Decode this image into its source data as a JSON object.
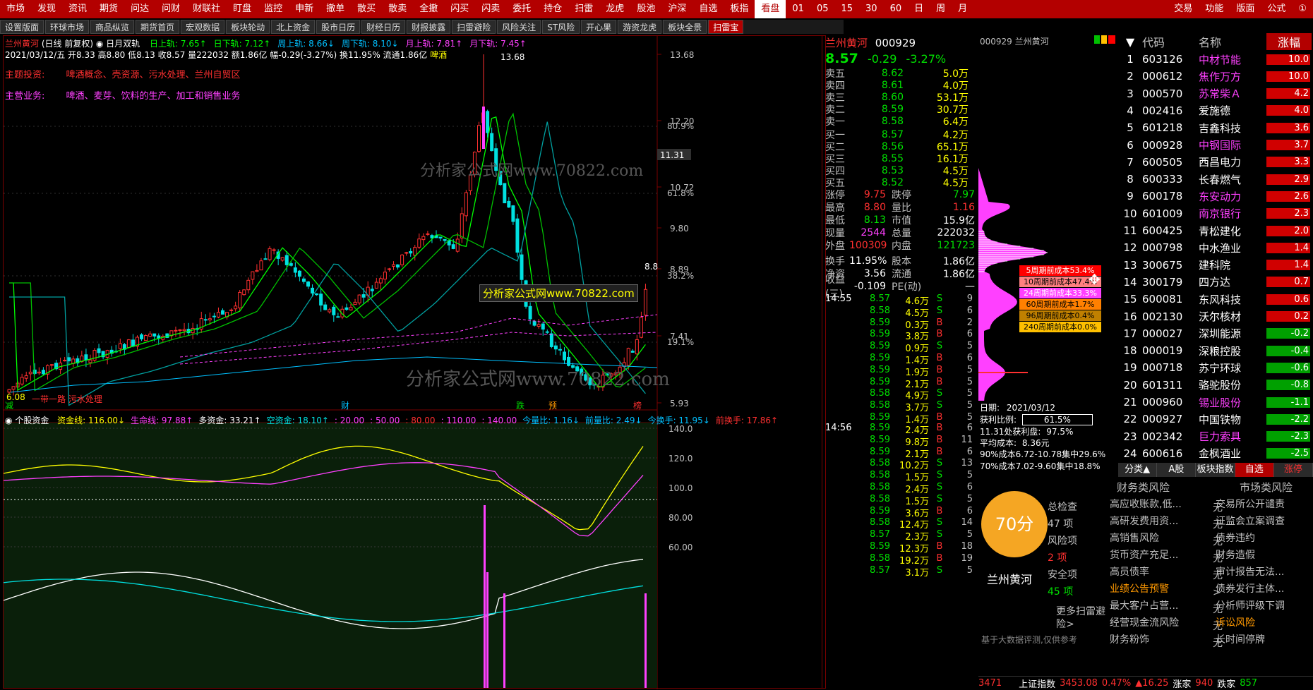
{
  "topbar": {
    "items": [
      "市场",
      "发现",
      "资讯",
      "期货",
      "问达",
      "问财",
      "财联社",
      "盯盘",
      "监控",
      "申新",
      "撤单",
      "散买",
      "散卖",
      "全撤",
      "闪买",
      "闪卖",
      "委托",
      "持仓",
      "扫雷",
      "龙虎",
      "股池",
      "沪深",
      "自选",
      "板指",
      "看盘",
      "01",
      "05",
      "15",
      "30",
      "60",
      "日",
      "周",
      "月"
    ],
    "right": [
      "交易",
      "功能",
      "版面",
      "公式",
      "①"
    ]
  },
  "tabs": [
    "设置版面",
    "环球市场",
    "商品纵览",
    "期货首页",
    "宏观数据",
    "板块轮动",
    "北上资金",
    "股市日历",
    "财经日历",
    "财报披露",
    "扫雷避险",
    "风险关注",
    "ST风险",
    "开心果",
    "游资龙虎",
    "板块全景",
    "扫雷宝"
  ],
  "chart": {
    "title_stock": "兰州黄河",
    "title_mode": "(日线 前复权)",
    "title_ind": "日月双轨",
    "ind_items": [
      {
        "t": "日上轨: 7.65↑",
        "c": "#00ff00"
      },
      {
        "t": "日下轨: 7.12↑",
        "c": "#00ff00"
      },
      {
        "t": "周上轨: 8.66↓",
        "c": "#00c0ff"
      },
      {
        "t": "周下轨: 8.10↓",
        "c": "#00c0ff"
      },
      {
        "t": "月上轨: 7.81↑",
        "c": "#ff40ff"
      },
      {
        "t": "月下轨: 7.45↑",
        "c": "#ff40ff"
      }
    ],
    "line2": "2021/03/12/五 开8.33 高8.80 低8.13 收8.57 量222032 额1.86亿 幅-0.29(-3.27%) 换11.95% 流通1.86亿",
    "line2_tag": "啤酒",
    "theme_label": "主题投资:",
    "theme_value": "啤酒概念、壳资源、污水处理、兰州自贸区",
    "biz_label": "主营业务:",
    "biz_value": "啤酒、麦芽、饮料的生产、加工和销售业务",
    "price_labels": [
      "13.68",
      "12.20",
      "10.72",
      "9.80",
      "8.89",
      "7.41",
      "5.93"
    ],
    "pct_labels": [
      "80.9%",
      "61.8%",
      "38.2%",
      "19.1%"
    ],
    "cur_price": "11.31",
    "high_mark": "13.68",
    "low_mark": "6.08",
    "right_mark": "8.8",
    "bottom_note": "一带一路 污水处理",
    "markers": [
      "减",
      "财",
      "跌",
      "预",
      "榜"
    ],
    "watermark1": "分析家公式网www.70822.com",
    "watermark2": "分析家公式网www.70822.com",
    "watermark3": "分析家公式网www.70822.com",
    "sub_title": "个股资金",
    "sub_items": [
      {
        "t": "资金线: 116.00↓",
        "c": "#ffff00"
      },
      {
        "t": "生命线: 97.88↑",
        "c": "#ff40ff"
      },
      {
        "t": "多资金: 33.21↑",
        "c": "#ffffff"
      },
      {
        "t": "空资金: 18.10↑",
        "c": "#00e0e0"
      },
      {
        "t": ": 20.00",
        "c": "#ff40ff"
      },
      {
        "t": ": 50.00",
        "c": "#ff40ff"
      },
      {
        "t": ": 80.00",
        "c": "#ff3030"
      },
      {
        "t": ": 110.00",
        "c": "#ff40ff"
      },
      {
        "t": ": 140.00",
        "c": "#ff40ff"
      },
      {
        "t": "今量比: 1.16↓",
        "c": "#00c0ff"
      },
      {
        "t": "前量比: 2.49↓",
        "c": "#00c0ff"
      },
      {
        "t": "今换手: 11.95↓",
        "c": "#00c0ff"
      },
      {
        "t": "前换手: 17.86↑",
        "c": "#ff3030"
      }
    ],
    "sub_labels": [
      "140.0",
      "120.0",
      "100.0",
      "80.00",
      "60.00"
    ]
  },
  "book": {
    "name": "兰州黄河",
    "code": "000929",
    "price": "8.57",
    "chg": "-0.29",
    "pct": "-3.27%",
    "asks": [
      {
        "l": "卖五",
        "p": "8.62",
        "v": "5.0万"
      },
      {
        "l": "卖四",
        "p": "8.61",
        "v": "4.0万"
      },
      {
        "l": "卖三",
        "p": "8.60",
        "v": "53.1万"
      },
      {
        "l": "卖二",
        "p": "8.59",
        "v": "30.7万"
      },
      {
        "l": "卖一",
        "p": "8.58",
        "v": "6.4万"
      }
    ],
    "bids": [
      {
        "l": "买一",
        "p": "8.57",
        "v": "4.2万"
      },
      {
        "l": "买二",
        "p": "8.56",
        "v": "65.1万"
      },
      {
        "l": "买三",
        "p": "8.55",
        "v": "16.1万"
      },
      {
        "l": "买四",
        "p": "8.53",
        "v": "4.5万"
      },
      {
        "l": "买五",
        "p": "8.52",
        "v": "4.5万"
      }
    ],
    "stats": [
      {
        "a": "涨停",
        "av": "9.75",
        "ac": "#ff3030",
        "b": "跌停",
        "bv": "7.97",
        "bc": "#00e000"
      },
      {
        "a": "最高",
        "av": "8.80",
        "ac": "#ff3030",
        "b": "量比",
        "bv": "1.16",
        "bc": "#ff3030"
      },
      {
        "a": "最低",
        "av": "8.13",
        "ac": "#00e000",
        "b": "市值",
        "bv": "15.9亿",
        "bc": "#ffffff"
      },
      {
        "a": "现量",
        "av": "2544",
        "ac": "#ff40ff",
        "b": "总量",
        "bv": "222032",
        "bc": "#ffffff"
      },
      {
        "a": "外盘",
        "av": "100309",
        "ac": "#ff3030",
        "b": "内盘",
        "bv": "121723",
        "bc": "#00e000"
      },
      {
        "a": "换手",
        "av": "11.95%",
        "ac": "#ffffff",
        "b": "股本",
        "bv": "1.86亿",
        "bc": "#ffffff"
      },
      {
        "a": "净资",
        "av": "3.56",
        "ac": "#ffffff",
        "b": "流通",
        "bv": "1.86亿",
        "bc": "#ffffff"
      },
      {
        "a": "收益(三)",
        "av": "-0.109",
        "ac": "#ffffff",
        "b": "PE(动)",
        "bv": "—",
        "bc": "#ffffff"
      }
    ],
    "ticks1_time": "14:55",
    "ticks1": [
      {
        "p": "8.57",
        "v": "4.6万",
        "s": "S",
        "n": "9"
      },
      {
        "p": "8.58",
        "v": "4.5万",
        "s": "S",
        "n": "6"
      },
      {
        "p": "8.59",
        "v": "0.3万",
        "s": "B",
        "n": "2"
      },
      {
        "p": "8.59",
        "v": "3.8万",
        "s": "B",
        "n": "6"
      },
      {
        "p": "8.59",
        "v": "0.9万",
        "s": "S",
        "n": "5"
      },
      {
        "p": "8.59",
        "v": "1.4万",
        "s": "B",
        "n": "6"
      },
      {
        "p": "8.59",
        "v": "1.9万",
        "s": "B",
        "n": "5"
      },
      {
        "p": "8.59",
        "v": "2.1万",
        "s": "B",
        "n": "5"
      },
      {
        "p": "8.58",
        "v": "4.9万",
        "s": "S",
        "n": "5"
      },
      {
        "p": "8.58",
        "v": "3.7万",
        "s": "S",
        "n": "5"
      },
      {
        "p": "8.59",
        "v": "1.4万",
        "s": "B",
        "n": "5"
      }
    ],
    "ticks2_time": "14:56",
    "ticks2": [
      {
        "p": "8.59",
        "v": "2.4万",
        "s": "B",
        "n": "6"
      },
      {
        "p": "8.59",
        "v": "9.8万",
        "s": "B",
        "n": "11"
      },
      {
        "p": "8.59",
        "v": "2.1万",
        "s": "B",
        "n": "6"
      },
      {
        "p": "8.58",
        "v": "10.2万",
        "s": "S",
        "n": "13"
      },
      {
        "p": "8.58",
        "v": "1.5万",
        "s": "S",
        "n": "5"
      },
      {
        "p": "8.58",
        "v": "2.4万",
        "s": "S",
        "n": "6"
      },
      {
        "p": "8.58",
        "v": "1.5万",
        "s": "S",
        "n": "5"
      },
      {
        "p": "8.59",
        "v": "3.6万",
        "s": "B",
        "n": "6"
      },
      {
        "p": "8.58",
        "v": "12.4万",
        "s": "S",
        "n": "14"
      },
      {
        "p": "8.57",
        "v": "2.3万",
        "s": "S",
        "n": "5"
      },
      {
        "p": "8.59",
        "v": "12.3万",
        "s": "B",
        "n": "18"
      },
      {
        "p": "8.58",
        "v": "19.2万",
        "s": "B",
        "n": "19"
      },
      {
        "p": "8.57",
        "v": "3.1万",
        "s": "S",
        "n": "5"
      }
    ]
  },
  "dist": {
    "title": "000929 兰州黄河",
    "cost_labels": [
      {
        "t": "5周期前成本53.4%",
        "bg": "#ff0000",
        "fg": "#ffffff"
      },
      {
        "t": "10周期前成本47.4%",
        "bg": "#ff8080",
        "fg": "#000000"
      },
      {
        "t": "24周期前成本33.3%",
        "bg": "#ff40ff",
        "fg": "#ffffff"
      },
      {
        "t": "60周期前成本1.7%",
        "bg": "#ff8000",
        "fg": "#000000"
      },
      {
        "t": "96周期前成本0.4%",
        "bg": "#c08000",
        "fg": "#000000"
      },
      {
        "t": "240周期前成本0.0%",
        "bg": "#ffc000",
        "fg": "#000000"
      }
    ],
    "date_label": "日期:",
    "date": "2021/03/12",
    "profit_label": "获利比例:",
    "profit": "61.5%",
    "pos_label": "11.31处获利盘:",
    "pos_value": "97.5%",
    "avg_label": "平均成本:",
    "avg": "8.36元",
    "c90": "90%成本6.72-10.78集中29.6%",
    "c70": "70%成本7.02-9.60集中18.8%"
  },
  "rank": {
    "headers": [
      "代码",
      "名称",
      "涨幅"
    ],
    "rows": [
      {
        "i": "1",
        "c": "603126",
        "n": "中材节能",
        "nc": "#ff40ff",
        "p": "10.0"
      },
      {
        "i": "2",
        "c": "000612",
        "n": "焦作万方",
        "nc": "#ff40ff",
        "p": "10.0"
      },
      {
        "i": "3",
        "c": "000570",
        "n": "苏常柴Ａ",
        "nc": "#ff40ff",
        "p": "4.2"
      },
      {
        "i": "4",
        "c": "002416",
        "n": "爱施德",
        "nc": "#ffffff",
        "p": "4.0"
      },
      {
        "i": "5",
        "c": "601218",
        "n": "吉鑫科技",
        "nc": "#ffffff",
        "p": "3.6"
      },
      {
        "i": "6",
        "c": "000928",
        "n": "中钢国际",
        "nc": "#ff40ff",
        "p": "3.7"
      },
      {
        "i": "7",
        "c": "600505",
        "n": "西昌电力",
        "nc": "#ffffff",
        "p": "3.3"
      },
      {
        "i": "8",
        "c": "600333",
        "n": "长春燃气",
        "nc": "#ffffff",
        "p": "2.9"
      },
      {
        "i": "9",
        "c": "600178",
        "n": "东安动力",
        "nc": "#ff40ff",
        "p": "2.6"
      },
      {
        "i": "10",
        "c": "601009",
        "n": "南京银行",
        "nc": "#ff40ff",
        "p": "2.3"
      },
      {
        "i": "11",
        "c": "600425",
        "n": "青松建化",
        "nc": "#ffffff",
        "p": "2.0"
      },
      {
        "i": "12",
        "c": "000798",
        "n": "中水渔业",
        "nc": "#ffffff",
        "p": "1.4"
      },
      {
        "i": "13",
        "c": "300675",
        "n": "建科院",
        "nc": "#ffffff",
        "p": "1.4"
      },
      {
        "i": "14",
        "c": "300179",
        "n": "四方达",
        "nc": "#ffffff",
        "p": "0.7"
      },
      {
        "i": "15",
        "c": "600081",
        "n": "东风科技",
        "nc": "#ffffff",
        "p": "0.6"
      },
      {
        "i": "16",
        "c": "002130",
        "n": "沃尔核材",
        "nc": "#ffffff",
        "p": "0.2"
      },
      {
        "i": "17",
        "c": "000027",
        "n": "深圳能源",
        "nc": "#ffffff",
        "p": "-0.2"
      },
      {
        "i": "18",
        "c": "000019",
        "n": "深粮控股",
        "nc": "#ffffff",
        "p": "-0.4"
      },
      {
        "i": "19",
        "c": "000718",
        "n": "苏宁环球",
        "nc": "#ffffff",
        "p": "-0.6"
      },
      {
        "i": "20",
        "c": "601311",
        "n": "骆驼股份",
        "nc": "#ffffff",
        "p": "-0.8"
      },
      {
        "i": "21",
        "c": "000960",
        "n": "锡业股份",
        "nc": "#ff40ff",
        "p": "-1.1"
      },
      {
        "i": "22",
        "c": "000927",
        "n": "中国铁物",
        "nc": "#ffffff",
        "p": "-2.2"
      },
      {
        "i": "23",
        "c": "002342",
        "n": "巨力索具",
        "nc": "#ff40ff",
        "p": "-2.3"
      },
      {
        "i": "24",
        "c": "600616",
        "n": "金枫酒业",
        "nc": "#ffffff",
        "p": "-2.5"
      }
    ],
    "tabs": [
      "分类▲",
      "A股",
      "板块指数",
      "自选",
      "涨停"
    ]
  },
  "risk": {
    "score": "70分",
    "name": "兰州黄河",
    "total_label": "总检查",
    "total": "47 项",
    "risk_label": "风险项",
    "risk": "2 项",
    "safe_label": "安全项",
    "safe": "45 项",
    "more": "更多扫雷避险>",
    "note": "基于大数据评测,仅供参考",
    "fin_title": "财务类风险",
    "mkt_title": "市场类风险",
    "fin": [
      {
        "t": "高应收账款,低...",
        "v": "无",
        "c": "#c0c0c0"
      },
      {
        "t": "高研发费用资...",
        "v": "无",
        "c": "#c0c0c0"
      },
      {
        "t": "高销售风险",
        "v": "无",
        "c": "#c0c0c0"
      },
      {
        "t": "货币资产充足...",
        "v": "无",
        "c": "#c0c0c0"
      },
      {
        "t": "高员债率",
        "v": "无",
        "c": "#c0c0c0"
      },
      {
        "t": "业绩公告预警",
        "v": ">",
        "c": "#ff9900"
      },
      {
        "t": "最大客户占营...",
        "v": "无",
        "c": "#c0c0c0"
      },
      {
        "t": "经营现金流风险",
        "v": "无",
        "c": "#c0c0c0"
      },
      {
        "t": "财务粉饰",
        "v": "无",
        "c": "#c0c0c0"
      }
    ],
    "mkt": [
      {
        "t": "交易所公开谴责",
        "v": "无",
        "c": "#c0c0c0"
      },
      {
        "t": "证监会立案调查",
        "v": "无",
        "c": "#c0c0c0"
      },
      {
        "t": "债券违约",
        "v": "无",
        "c": "#c0c0c0"
      },
      {
        "t": "财务造假",
        "v": "无",
        "c": "#c0c0c0"
      },
      {
        "t": "审计报告无法...",
        "v": "无",
        "c": "#c0c0c0"
      },
      {
        "t": "债券发行主体...",
        "v": "无",
        "c": "#c0c0c0"
      },
      {
        "t": "分析师评级下调",
        "v": "无",
        "c": "#c0c0c0"
      },
      {
        "t": "诉讼风险",
        "v": ">",
        "c": "#ff9900"
      },
      {
        "t": "长时间停牌",
        "v": "无",
        "c": "#c0c0c0"
      }
    ]
  },
  "statusbar": {
    "num": "3471",
    "index_name": "上证指数",
    "index_val": "3453.08",
    "index_pct": "0.47%",
    "index_chg": "▲16.25",
    "up_label": "涨家",
    "up": "940",
    "down_label": "跌家",
    "down": "857"
  }
}
